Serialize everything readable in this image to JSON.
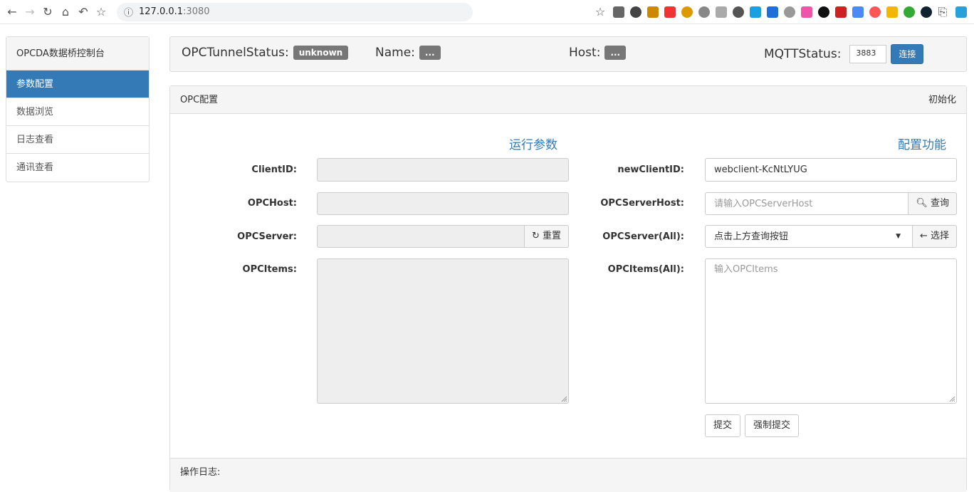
{
  "browser": {
    "url_host": "127.0.0.1",
    "url_port": ":3080"
  },
  "sidebar": {
    "title": "OPCDA数据桥控制台",
    "items": [
      {
        "label": "参数配置",
        "active": true
      },
      {
        "label": "数据浏览",
        "active": false
      },
      {
        "label": "日志查看",
        "active": false
      },
      {
        "label": "通讯查看",
        "active": false
      }
    ]
  },
  "status": {
    "tunnel_label": "OPCTunnelStatus:",
    "tunnel_value": "unknown",
    "name_label": "Name:",
    "name_value": "...",
    "host_label": "Host:",
    "host_value": "...",
    "mqtt_label": "MQTTStatus:",
    "mqtt_value": "3883",
    "connect_label": "连接"
  },
  "panel": {
    "title": "OPC配置",
    "init_label": "初始化",
    "runtime_title": "运行参数",
    "config_title": "配置功能",
    "log_label": "操作日志:"
  },
  "runtime": {
    "clientid_label": "ClientID:",
    "opchost_label": "OPCHost:",
    "opcserver_label": "OPCServer:",
    "opcitems_label": "OPCItems:",
    "reset_label": "重置"
  },
  "config": {
    "newclientid_label": "newClientID:",
    "newclientid_value": "webclient-KcNtLYUG",
    "serverhost_label": "OPCServerHost:",
    "serverhost_placeholder": "请输入OPCServerHost",
    "query_label": "查询",
    "serverall_label": "OPCServer(All):",
    "serverall_selected": "点击上方查询按钮",
    "select_label": "选择",
    "itemsall_label": "OPCItems(All):",
    "itemsall_placeholder": "输入OPCItems",
    "submit_label": "提交",
    "force_submit_label": "强制提交"
  },
  "colors": {
    "primary": "#337ab7",
    "badge": "#777777"
  }
}
